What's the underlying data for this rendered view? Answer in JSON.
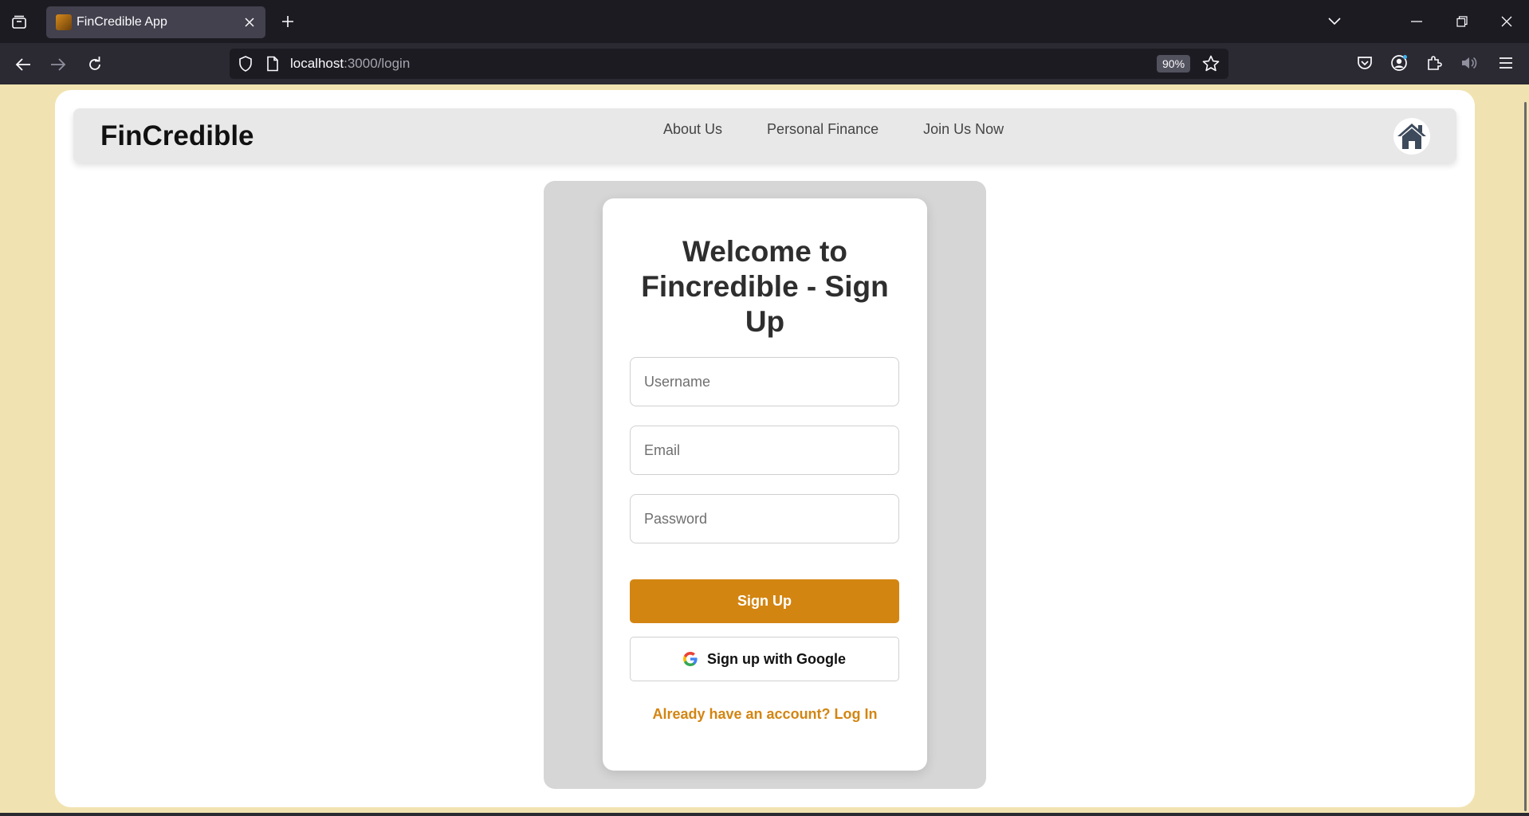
{
  "browser": {
    "tab_title": "FinCredible App",
    "url_host": "localhost",
    "url_rest": ":3000/login",
    "zoom": "90%"
  },
  "header": {
    "brand": "FinCredible",
    "nav": [
      "About Us",
      "Personal Finance",
      "Join Us Now"
    ]
  },
  "form": {
    "title": "Welcome to Fincredible - Sign Up",
    "username_placeholder": "Username",
    "email_placeholder": "Email",
    "password_placeholder": "Password",
    "signup_label": "Sign Up",
    "google_label": "Sign up with Google",
    "login_link": "Already have an account? Log In"
  },
  "colors": {
    "accent": "#d38512",
    "page_bg": "#f1e3b1"
  }
}
